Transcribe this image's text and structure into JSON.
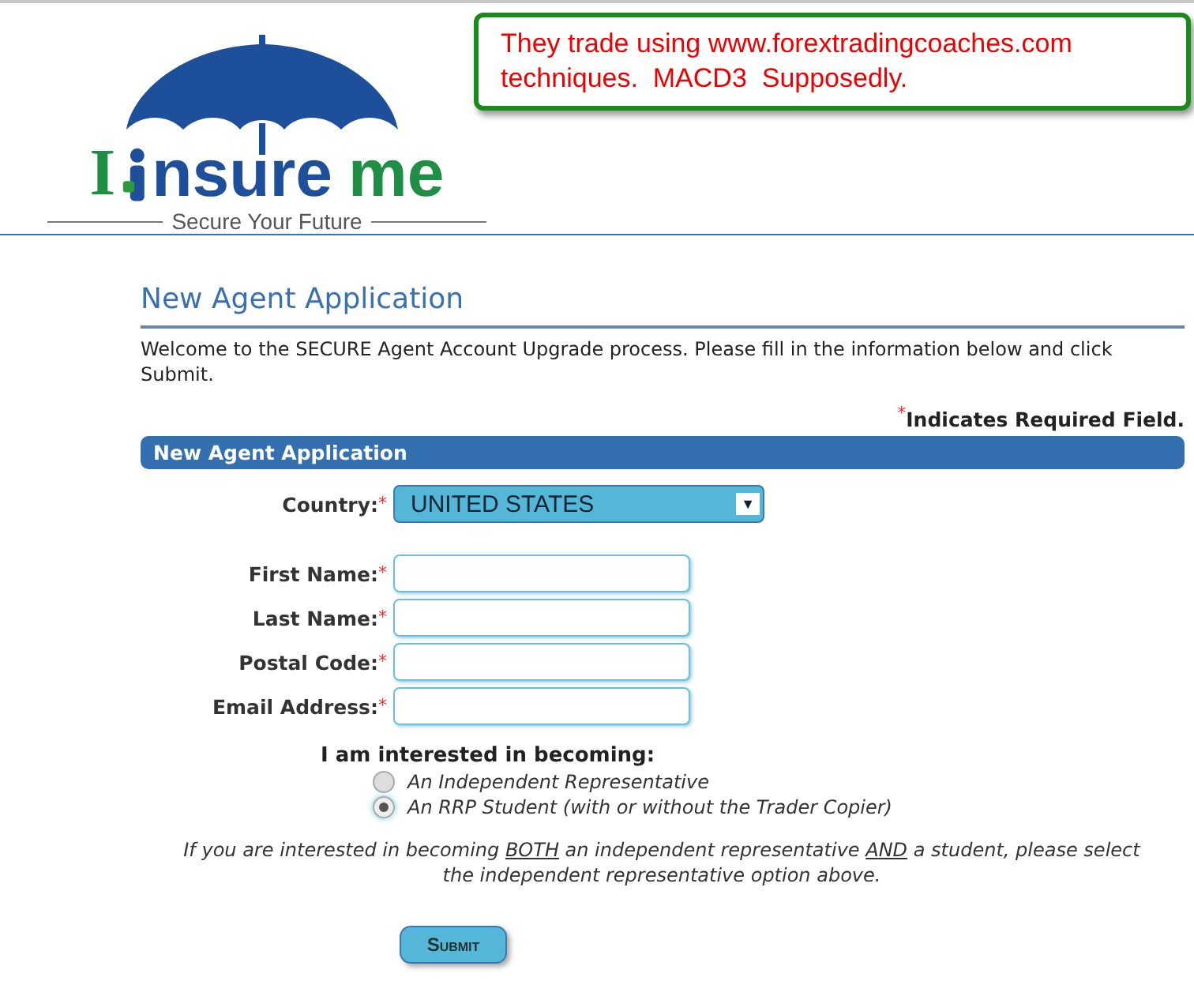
{
  "logo": {
    "letter": "I",
    "word_middle": "nsure",
    "word_end": "me",
    "tagline": "Secure Your Future"
  },
  "callout": {
    "text": "They trade using www.forextradingcoaches.com techniques.  MACD3  Supposedly."
  },
  "page_title": "New Agent Application",
  "intro": "Welcome to the SECURE Agent Account Upgrade process. Please fill in the information below and click Submit.",
  "required_note": {
    "mark": "*",
    "text": "Indicates Required Field."
  },
  "section_header": "New Agent Application",
  "country": {
    "label": "Country:",
    "mark": "*",
    "value": "UNITED STATES",
    "arrow": "▼"
  },
  "fields": [
    {
      "label": "First Name:",
      "mark": "*"
    },
    {
      "label": "Last Name:",
      "mark": "*"
    },
    {
      "label": "Postal Code:",
      "mark": "*"
    },
    {
      "label": "Email Address:",
      "mark": "*"
    }
  ],
  "interest": {
    "label": "I am interested in becoming:",
    "options": [
      {
        "label": "An Independent Representative",
        "selected": false
      },
      {
        "label": "An RRP Student (with or without the Trader Copier)",
        "selected": true
      }
    ]
  },
  "note": [
    {
      "text": "If you are interested in becoming ",
      "underlined": false
    },
    {
      "text": "BOTH",
      "underlined": true
    },
    {
      "text": " an independent representative ",
      "underlined": false
    },
    {
      "text": "AND",
      "underlined": true
    },
    {
      "text": " a student, please select the independent representative option above.",
      "underlined": false
    }
  ],
  "submit": "Submit"
}
